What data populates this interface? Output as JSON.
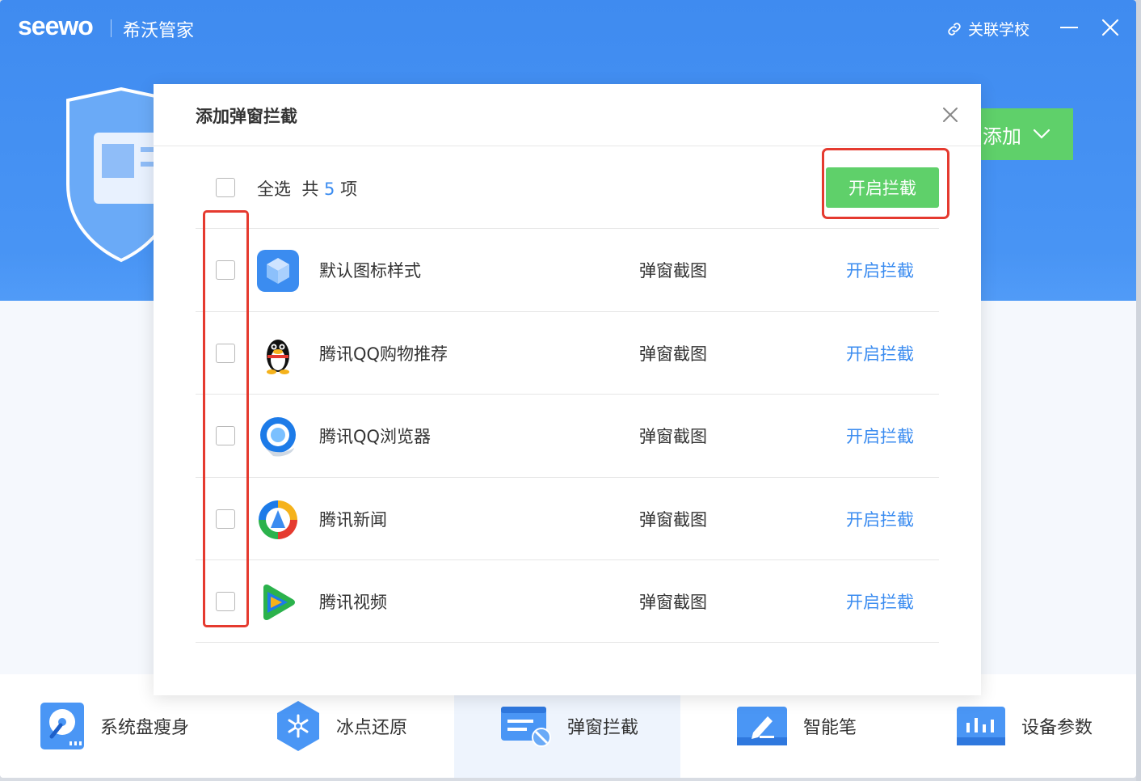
{
  "app": {
    "logo": "seewo",
    "name": "希沃管家",
    "link_school": "关联学校"
  },
  "header": {
    "add_label": "添加"
  },
  "dialog": {
    "title": "添加弹窗拦截",
    "select_all": "全选",
    "count_prefix": "共",
    "count": "5",
    "count_suffix": "项",
    "open_block_button": "开启拦截",
    "rows": [
      {
        "name": "默认图标样式",
        "type": "弹窗截图",
        "action": "开启拦截",
        "icon": "cube-app-icon"
      },
      {
        "name": "腾讯QQ购物推荐",
        "type": "弹窗截图",
        "action": "开启拦截",
        "icon": "qq-penguin-icon"
      },
      {
        "name": "腾讯QQ浏览器",
        "type": "弹窗截图",
        "action": "开启拦截",
        "icon": "qq-browser-icon"
      },
      {
        "name": "腾讯新闻",
        "type": "弹窗截图",
        "action": "开启拦截",
        "icon": "tencent-news-icon"
      },
      {
        "name": "腾讯视频",
        "type": "弹窗截图",
        "action": "开启拦截",
        "icon": "tencent-video-icon"
      }
    ]
  },
  "tools": [
    {
      "label": "系统盘瘦身",
      "icon": "disk-clean-icon"
    },
    {
      "label": "冰点还原",
      "icon": "freeze-restore-icon"
    },
    {
      "label": "弹窗拦截",
      "icon": "popup-block-icon",
      "active": true
    },
    {
      "label": "智能笔",
      "icon": "smart-pen-icon"
    },
    {
      "label": "设备参数",
      "icon": "device-params-icon"
    }
  ],
  "colors": {
    "header_blue": "#4a96f5",
    "green": "#5fd06a",
    "link_blue": "#3b8cf0",
    "highlight_red": "#e53a2f"
  }
}
